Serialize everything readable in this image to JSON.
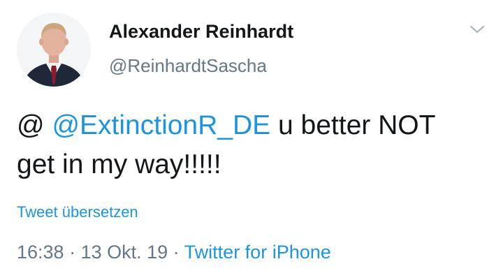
{
  "author": {
    "name": "Alexander Reinhardt",
    "handle": "@ReinhardtSascha"
  },
  "menu_icon": "chevron-down-icon",
  "tweet": {
    "prefix": "@ ",
    "mention": "@ExtinctionR_DE",
    "line1_rest": " u better NOT",
    "line2": "get in my way!!!!!"
  },
  "translate_label": "Tweet übersetzen",
  "meta": {
    "time": "16:38",
    "separator": " · ",
    "date": "13 Okt. 19",
    "source": "Twitter for iPhone"
  },
  "colors": {
    "link": "#1b95e0",
    "secondary_text": "#657786",
    "primary_text": "#14171a"
  }
}
